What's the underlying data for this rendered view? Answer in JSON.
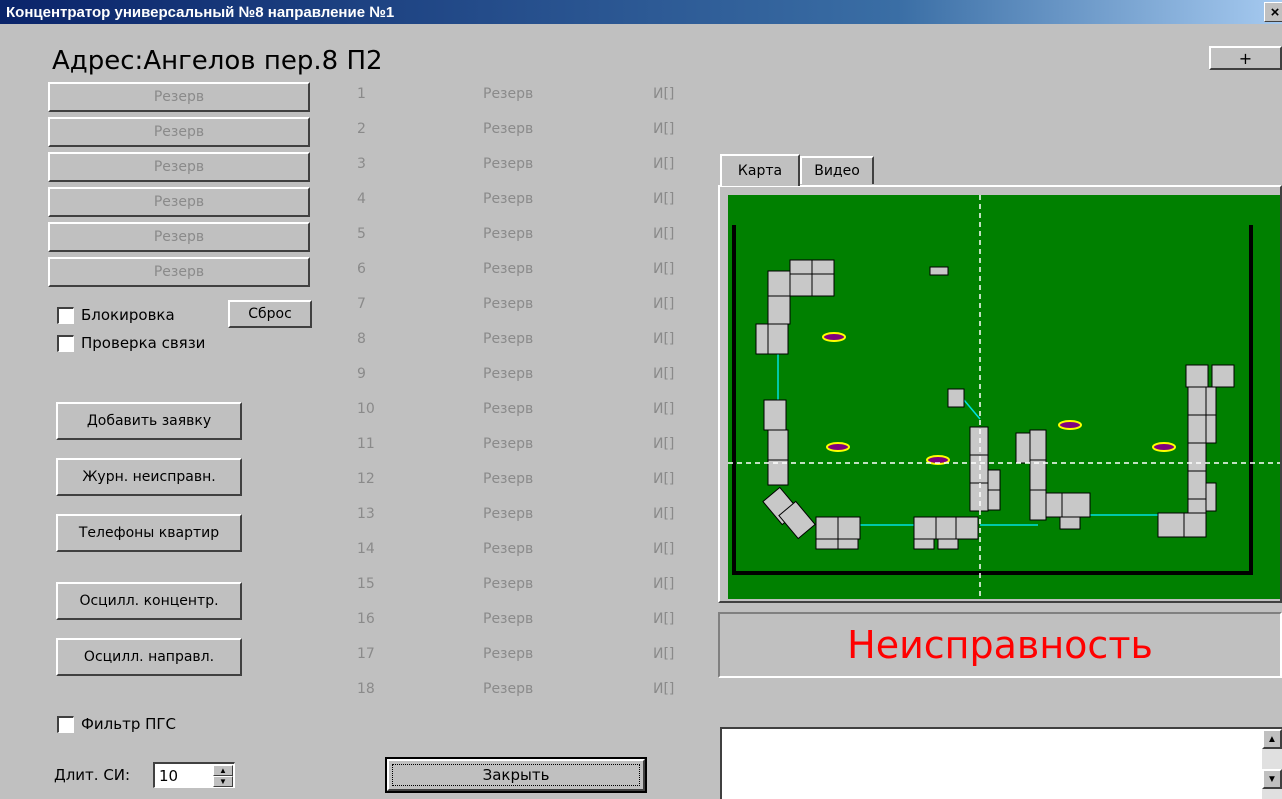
{
  "window": {
    "title": "Концентратор универсальный №8 направление №1",
    "close_label": "×"
  },
  "address": "Адрес:Ангелов пер.8 П2",
  "plus_label": "+",
  "reserve_buttons": [
    "Резерв",
    "Резерв",
    "Резерв",
    "Резерв",
    "Резерв",
    "Резерв"
  ],
  "block_label": "Блокировка",
  "reset_label": "Сброс",
  "check_link_label": "Проверка связи",
  "actions": {
    "add_request": "Добавить заявку",
    "fault_log": "Журн. неисправн.",
    "apartment_phones": "Телефоны квартир",
    "osc_concentrator": "Осцилл. концентр.",
    "osc_direction": "Осцилл. направл."
  },
  "filter_label": "Фильтр ПГС",
  "duration": {
    "label": "Длит. СИ:",
    "value": "10",
    "up": "▲",
    "down": "▼"
  },
  "close_label": "Закрыть",
  "channels": [
    {
      "num": "1",
      "label": "Резерв",
      "flag": "И[]"
    },
    {
      "num": "2",
      "label": "Резерв",
      "flag": "И[]"
    },
    {
      "num": "3",
      "label": "Резерв",
      "flag": "И[]"
    },
    {
      "num": "4",
      "label": "Резерв",
      "flag": "И[]"
    },
    {
      "num": "5",
      "label": "Резерв",
      "flag": "И[]"
    },
    {
      "num": "6",
      "label": "Резерв",
      "flag": "И[]"
    },
    {
      "num": "7",
      "label": "Резерв",
      "flag": "И[]"
    },
    {
      "num": "8",
      "label": "Резерв",
      "flag": "И[]"
    },
    {
      "num": "9",
      "label": "Резерв",
      "flag": "И[]"
    },
    {
      "num": "10",
      "label": "Резерв",
      "flag": "И[]"
    },
    {
      "num": "11",
      "label": "Резерв",
      "flag": "И[]"
    },
    {
      "num": "12",
      "label": "Резерв",
      "flag": "И[]"
    },
    {
      "num": "13",
      "label": "Резерв",
      "flag": "И[]"
    },
    {
      "num": "14",
      "label": "Резерв",
      "flag": "И[]"
    },
    {
      "num": "15",
      "label": "Резерв",
      "flag": "И[]"
    },
    {
      "num": "16",
      "label": "Резерв",
      "flag": "И[]"
    },
    {
      "num": "17",
      "label": "Резерв",
      "flag": "И[]"
    },
    {
      "num": "18",
      "label": "Резерв",
      "flag": "И[]"
    }
  ],
  "tabs": [
    {
      "label": "Карта"
    },
    {
      "label": "Видео"
    }
  ],
  "status_text": "Неисправность",
  "colors": {
    "map_background": "#008000",
    "building_fill": "#c8c8c8",
    "link_line": "#00ffff",
    "marker_fill": "#800080",
    "marker_ring": "#ffff00",
    "status": "#ff0000"
  },
  "memo": {
    "up": "▲",
    "down": "▼"
  }
}
